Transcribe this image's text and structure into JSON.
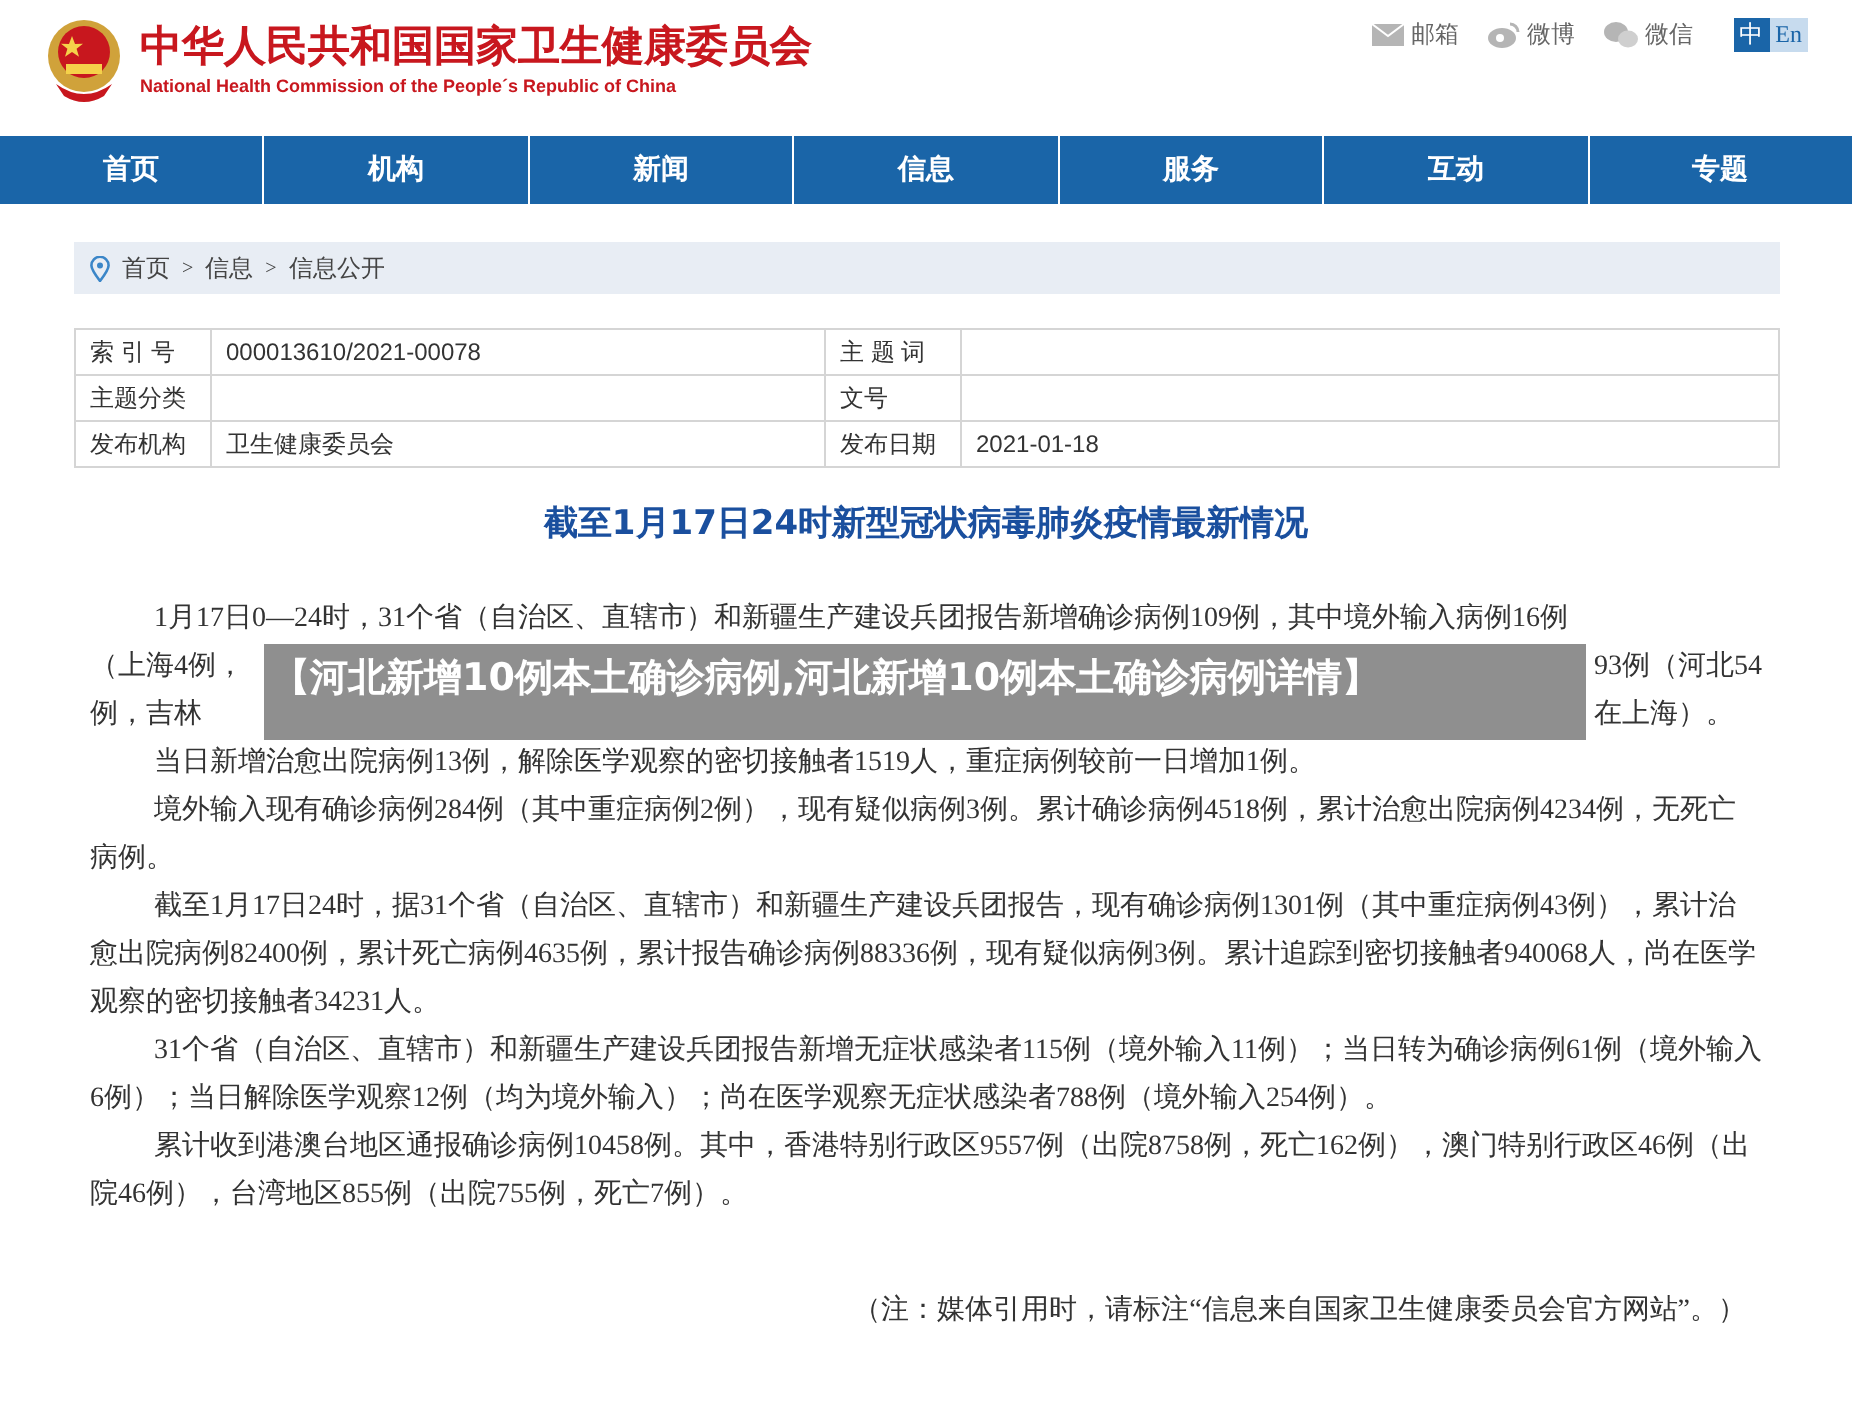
{
  "header": {
    "title": "中华人民共和国国家卫生健康委员会",
    "subtitle": "National Health Commission of the People´s Republic of China",
    "links": [
      {
        "kind": "mail",
        "label": "邮箱"
      },
      {
        "kind": "weibo",
        "label": "微博"
      },
      {
        "kind": "wechat",
        "label": "微信"
      }
    ],
    "languages": [
      {
        "label": "中",
        "selected": true
      },
      {
        "label": "En",
        "selected": false
      }
    ]
  },
  "nav": [
    "首页",
    "机构",
    "新闻",
    "信息",
    "服务",
    "互动",
    "专题"
  ],
  "breadcrumb": {
    "separator": ">",
    "items": [
      "首页",
      "信息",
      "信息公开"
    ]
  },
  "meta": [
    [
      {
        "label": "索 引 号",
        "value": "000013610/2021-00078"
      },
      {
        "label": "主 题 词"
      }
    ],
    [
      {
        "label": "主题分类"
      },
      {
        "label": "文号"
      }
    ],
    [
      {
        "label": "发布机构",
        "value": "卫生健康委员会"
      },
      {
        "label": "发布日期",
        "value": "2021-01-18"
      }
    ]
  ],
  "article": {
    "title": "截至1月17日24时新型冠状病毒肺炎疫情最新情况",
    "lead": {
      "first_line": "1月17日0—24时，31个省（自治区、直辖市）和新疆生产建设兵团报告新增确诊病例109例，其中境外输入病例16例",
      "left": [
        "（上海4例，",
        "例，吉林"
      ],
      "right": [
        "93例（河北54",
        "在上海）。"
      ]
    },
    "paragraphs": [
      "当日新增治愈出院病例13例，解除医学观察的密切接触者1519人，重症病例较前一日增加1例。",
      "境外输入现有确诊病例284例（其中重症病例2例），现有疑似病例3例。累计确诊病例4518例，累计治愈出院病例4234例，无死亡病例。",
      "截至1月17日24时，据31个省（自治区、直辖市）和新疆生产建设兵团报告，现有确诊病例1301例（其中重症病例43例），累计治愈出院病例82400例，累计死亡病例4635例，累计报告确诊病例88336例，现有疑似病例3例。累计追踪到密切接触者940068人，尚在医学观察的密切接触者34231人。",
      "31个省（自治区、直辖市）和新疆生产建设兵团报告新增无症状感染者115例（境外输入11例）；当日转为确诊病例61例（境外输入6例）；当日解除医学观察12例（均为境外输入）；尚在医学观察无症状感染者788例（境外输入254例）。",
      "累计收到港澳台地区通报确诊病例10458例。其中，香港特别行政区9557例（出院8758例，死亡162例），澳门特别行政区46例（出院46例），台湾地区855例（出院755例，死亡7例）。"
    ],
    "note": "（注：媒体引用时，请标注“信息来自国家卫生健康委员会官方网站”。）"
  },
  "banner": "【河北新增10例本土确诊病例,河北新增10例本土确诊病例详情】"
}
